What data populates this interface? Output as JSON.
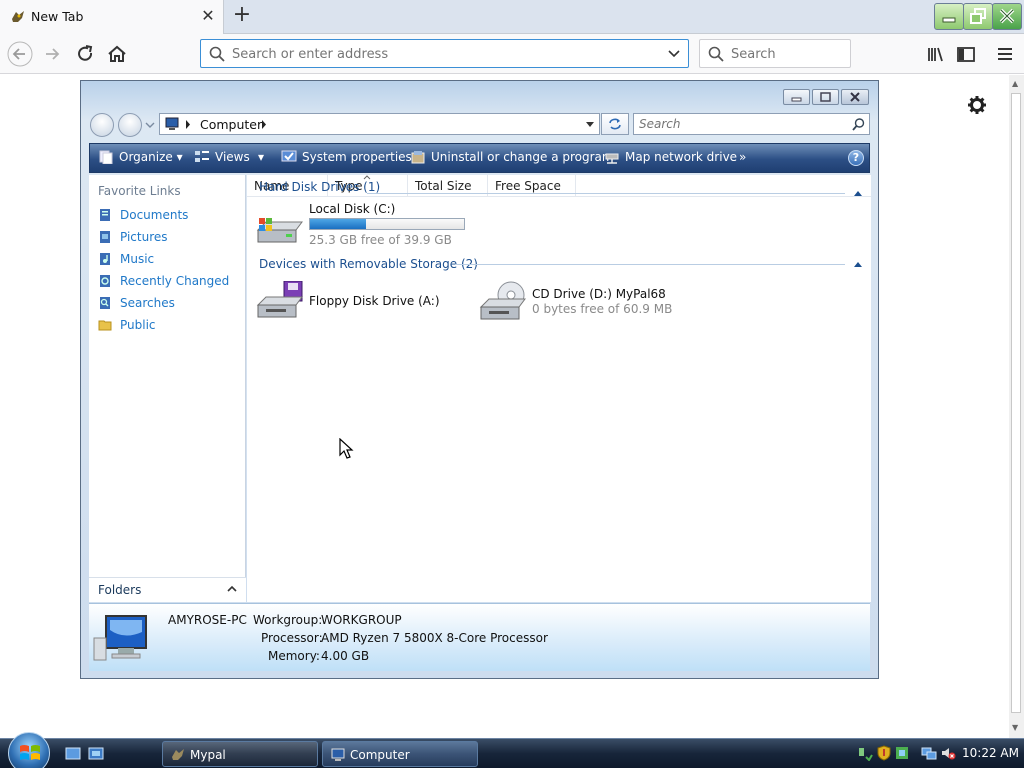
{
  "browser": {
    "tab_title": "New Tab",
    "url_placeholder": "Search or enter address",
    "search_placeholder": "Search"
  },
  "explorer": {
    "breadcrumb": "Computer",
    "search_placeholder": "Search",
    "commands": {
      "organize": "Organize",
      "views": "Views",
      "system_properties": "System properties",
      "uninstall": "Uninstall or change a program",
      "map_drive": "Map network drive"
    },
    "favorite_links_title": "Favorite Links",
    "favorite_links": [
      {
        "label": "Documents",
        "icon": "documents-icon"
      },
      {
        "label": "Pictures",
        "icon": "pictures-icon"
      },
      {
        "label": "Music",
        "icon": "music-icon"
      },
      {
        "label": "Recently Changed",
        "icon": "recently-changed-icon"
      },
      {
        "label": "Searches",
        "icon": "searches-icon"
      },
      {
        "label": "Public",
        "icon": "public-folder-icon"
      }
    ],
    "folders_label": "Folders",
    "columns": [
      "Name",
      "Type",
      "Total Size",
      "Free Space"
    ],
    "groups": [
      {
        "title": "Hard Disk Drives (1)",
        "items": [
          {
            "name": "Local Disk (C:)",
            "free_text": "25.3 GB free of 39.9 GB",
            "used_fraction": 0.366
          }
        ]
      },
      {
        "title": "Devices with Removable Storage (2)",
        "items": [
          {
            "name": "Floppy Disk Drive (A:)"
          },
          {
            "name": "CD Drive (D:) MyPal68",
            "free_text": "0 bytes free of 60.9 MB"
          }
        ]
      }
    ],
    "details": {
      "computer_name": "AMYROSE-PC",
      "workgroup_label": "Workgroup:",
      "workgroup": "WORKGROUP",
      "processor_label": "Processor:",
      "processor": "AMD Ryzen 7 5800X 8-Core Processor",
      "memory_label": "Memory:",
      "memory": "4.00 GB"
    }
  },
  "taskbar": {
    "buttons": [
      "Mypal",
      "Computer"
    ],
    "clock": "10:22 AM"
  },
  "colors": {
    "link_blue": "#1f78c8",
    "command_bar": "#2c4f85",
    "capacity_bar": "#1a6fc1"
  }
}
